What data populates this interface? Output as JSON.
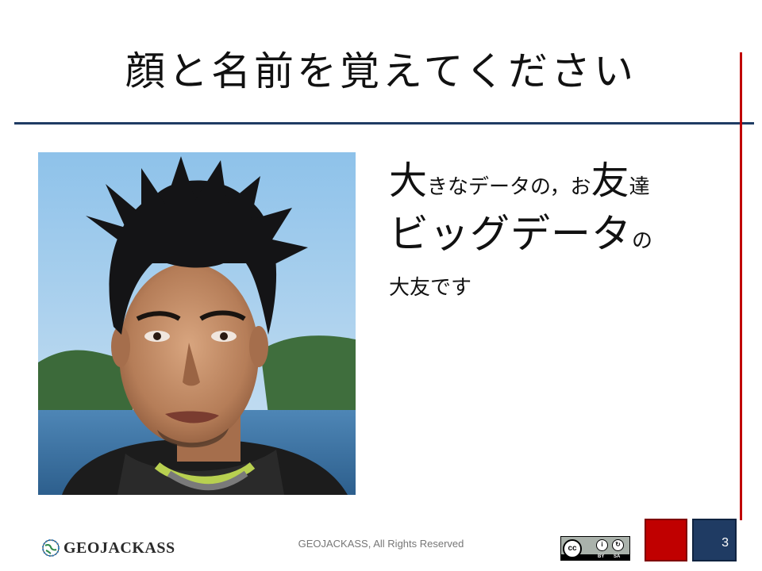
{
  "slide": {
    "title": "顔と名前を覚えてください",
    "body": {
      "line1": {
        "a": "大",
        "b": "きなデータの，お",
        "c": "友",
        "d": "達"
      },
      "line2": {
        "a": "ビッグデータ",
        "b": "の"
      },
      "line3": "大友です"
    },
    "page_number": "3"
  },
  "footer": {
    "copyright": "GEOJACKASS, All Rights Reserved",
    "logo_text": "GEOJACKASS",
    "license": {
      "mark": "cc",
      "by": "BY",
      "sa": "SA"
    }
  },
  "colors": {
    "accent_red": "#c00000",
    "accent_navy": "#1f3b63"
  },
  "icons": [
    "globe-logo-icon",
    "cc-by-sa-icon"
  ]
}
